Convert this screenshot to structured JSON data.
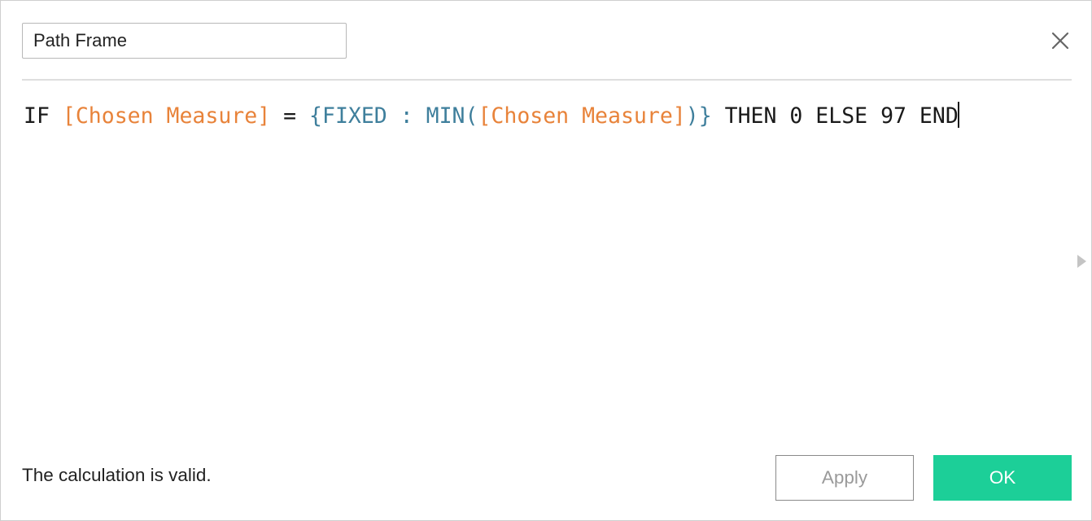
{
  "dialog": {
    "name_value": "Path Frame",
    "close_icon": "close-icon",
    "formula": {
      "t01": "IF ",
      "t02": "[Chosen Measure]",
      "t03": " = ",
      "t04": "{FIXED : MIN(",
      "t05": "[Chosen Measure]",
      "t06": ")}",
      "t07": " THEN 0 ELSE 97 END"
    },
    "side_arrow_icon": "triangle-right-icon",
    "status": "The calculation is valid.",
    "apply_label": "Apply",
    "ok_label": "OK"
  },
  "colors": {
    "field": "#e8833a",
    "function": "#3f7f9c",
    "keyword": "#1a1a1a",
    "ok_button": "#1ccf98"
  }
}
